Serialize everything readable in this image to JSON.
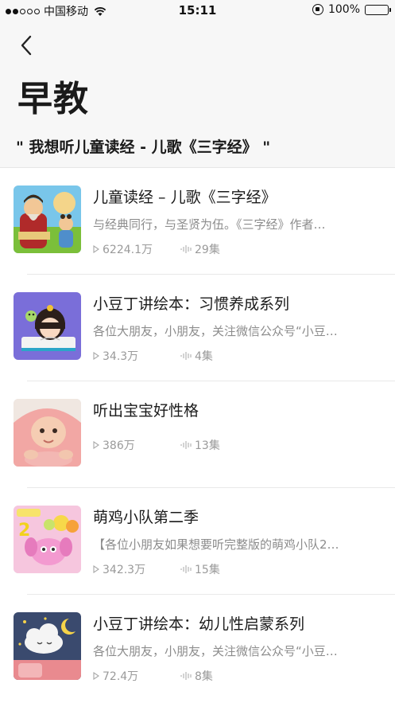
{
  "status_bar": {
    "carrier": "中国移动",
    "time": "15:11",
    "battery": "100%"
  },
  "header": {
    "title": "早教",
    "query": "\" 我想听儿童读经 - 儿歌《三字经》 \""
  },
  "items": [
    {
      "title": "儿童读经 – 儿歌《三字经》",
      "desc": "与经典同行，与圣贤为伍。《三字经》作者…",
      "plays": "6224.1万",
      "episodes": "29集",
      "icon": "thumb-sanzijing"
    },
    {
      "title": "小豆丁讲绘本：习惯养成系列",
      "desc": "各位大朋友，小朋友，关注微信公众号“小豆…",
      "plays": "34.3万",
      "episodes": "4集",
      "icon": "thumb-girl-book"
    },
    {
      "title": "听出宝宝好性格",
      "desc": "",
      "plays": "386万",
      "episodes": "13集",
      "icon": "thumb-baby"
    },
    {
      "title": "萌鸡小队第二季",
      "desc": "【各位小朋友如果想要听完整版的萌鸡小队2…",
      "plays": "342.3万",
      "episodes": "15集",
      "icon": "thumb-chicks"
    },
    {
      "title": "小豆丁讲绘本：幼儿性启蒙系列",
      "desc": "各位大朋友，小朋友，关注微信公众号“小豆…",
      "plays": "72.4万",
      "episodes": "8集",
      "icon": "thumb-cloud-moon"
    }
  ]
}
